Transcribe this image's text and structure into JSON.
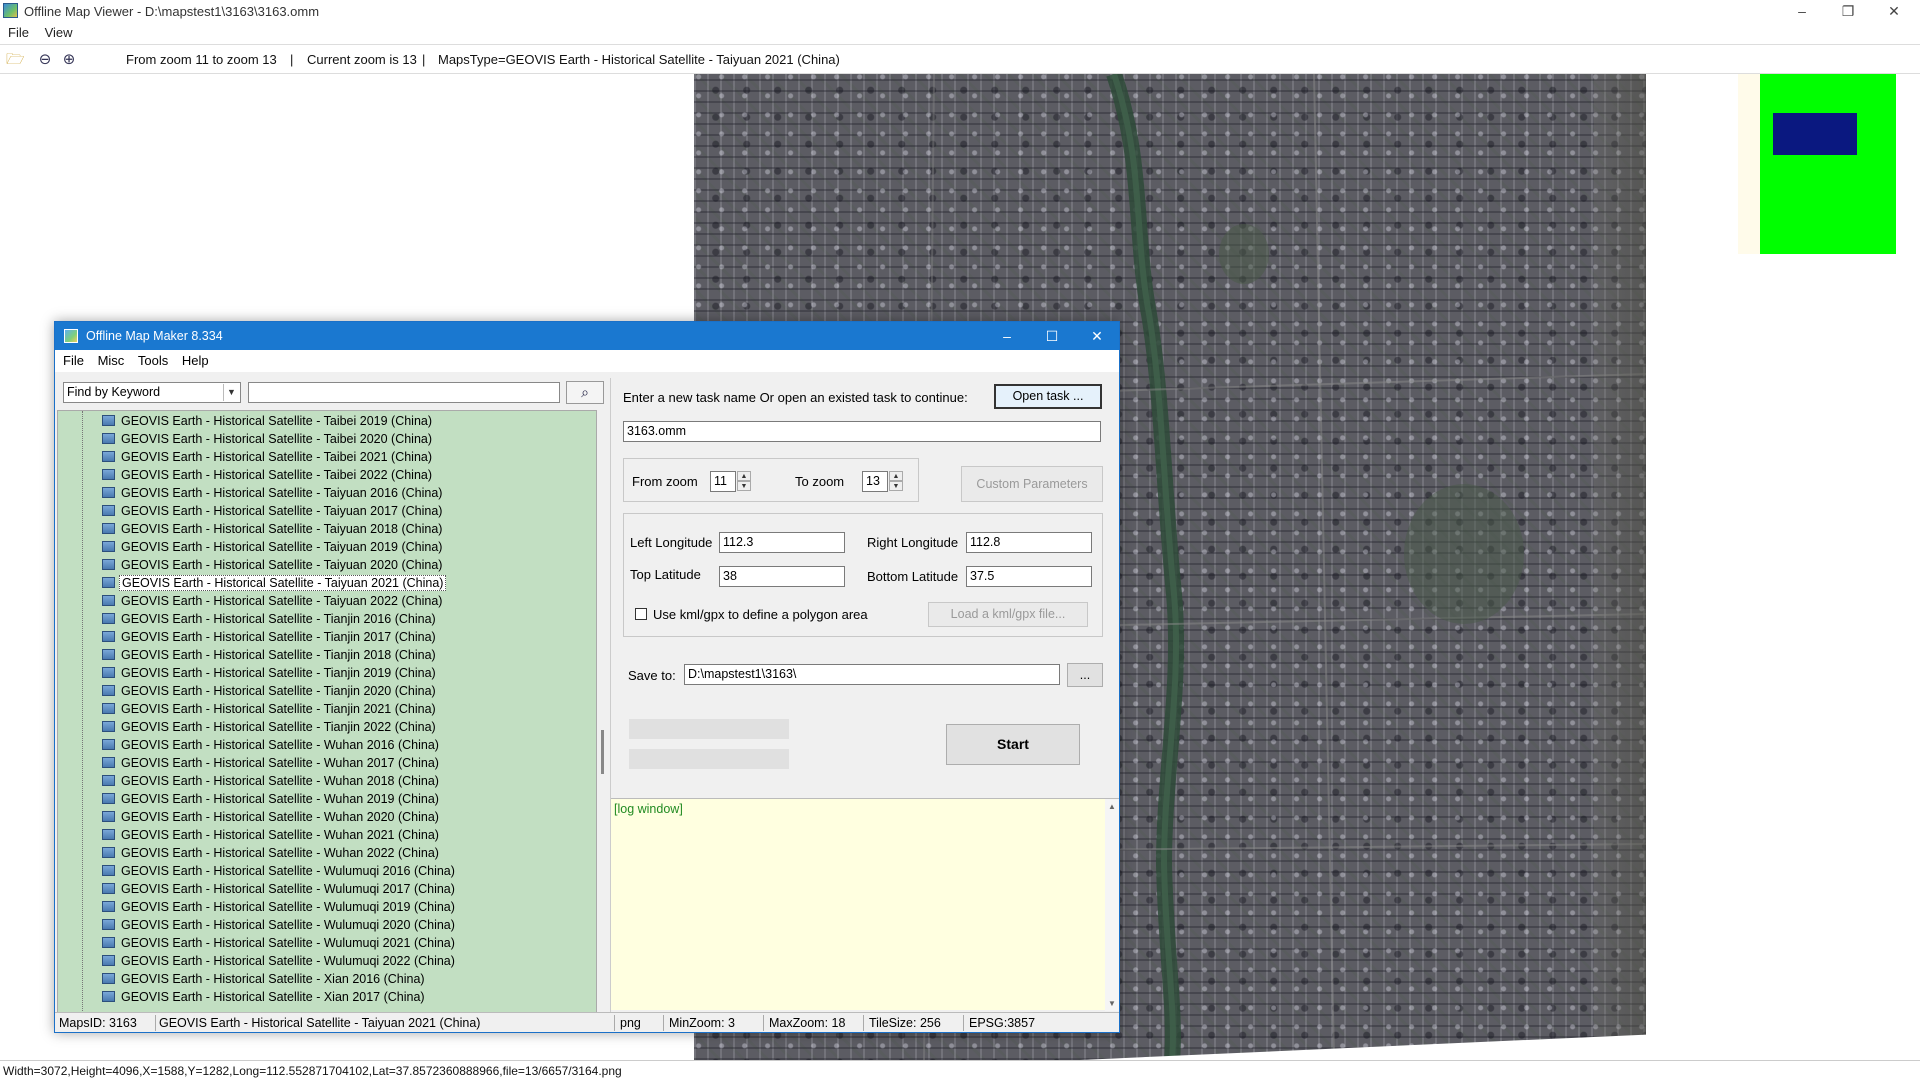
{
  "viewer": {
    "title": "Offline Map Viewer - D:\\mapstest1\\3163\\3163.omm",
    "window_buttons": {
      "minimize": "–",
      "maximize": "❐",
      "close": "✕"
    },
    "menu": [
      "File",
      "View"
    ],
    "toolbar": {
      "zoom_range": "From zoom 11 to zoom 13",
      "separator": "|",
      "current_zoom": "Current zoom is 13",
      "maps_type": "MapsType=GEOVIS Earth - Historical Satellite - Taiyuan 2021 (China)"
    },
    "status": "Width=3072,Height=4096,X=1588,Y=1282,Long=112.552871704102,Lat=37.8572360888966,file=13/6657/3164.png",
    "overview_colors": {
      "frame": "#00ff00",
      "viewport": "#0a1880"
    }
  },
  "dialog": {
    "title": "Offline Map Maker 8.334",
    "window_buttons": {
      "minimize": "–",
      "maximize": "☐",
      "close": "✕"
    },
    "menu": [
      "File",
      "Misc",
      "Tools",
      "Help"
    ],
    "find": {
      "mode": "Find by Keyword",
      "query": ""
    },
    "tree_items": [
      "GEOVIS Earth - Historical Satellite - Taibei 2019 (China)",
      "GEOVIS Earth - Historical Satellite - Taibei 2020 (China)",
      "GEOVIS Earth - Historical Satellite - Taibei 2021 (China)",
      "GEOVIS Earth - Historical Satellite - Taibei 2022 (China)",
      "GEOVIS Earth - Historical Satellite - Taiyuan 2016 (China)",
      "GEOVIS Earth - Historical Satellite - Taiyuan 2017 (China)",
      "GEOVIS Earth - Historical Satellite - Taiyuan 2018 (China)",
      "GEOVIS Earth - Historical Satellite - Taiyuan 2019 (China)",
      "GEOVIS Earth - Historical Satellite - Taiyuan 2020 (China)",
      "GEOVIS Earth - Historical Satellite - Taiyuan 2021 (China)",
      "GEOVIS Earth - Historical Satellite - Taiyuan 2022 (China)",
      "GEOVIS Earth - Historical Satellite - Tianjin 2016 (China)",
      "GEOVIS Earth - Historical Satellite - Tianjin 2017 (China)",
      "GEOVIS Earth - Historical Satellite - Tianjin 2018 (China)",
      "GEOVIS Earth - Historical Satellite - Tianjin 2019 (China)",
      "GEOVIS Earth - Historical Satellite - Tianjin 2020 (China)",
      "GEOVIS Earth - Historical Satellite - Tianjin 2021 (China)",
      "GEOVIS Earth - Historical Satellite - Tianjin 2022 (China)",
      "GEOVIS Earth - Historical Satellite - Wuhan 2016 (China)",
      "GEOVIS Earth - Historical Satellite - Wuhan 2017 (China)",
      "GEOVIS Earth - Historical Satellite - Wuhan 2018 (China)",
      "GEOVIS Earth - Historical Satellite - Wuhan 2019 (China)",
      "GEOVIS Earth - Historical Satellite - Wuhan 2020 (China)",
      "GEOVIS Earth - Historical Satellite - Wuhan 2021 (China)",
      "GEOVIS Earth - Historical Satellite - Wuhan 2022 (China)",
      "GEOVIS Earth - Historical Satellite - Wulumuqi 2016 (China)",
      "GEOVIS Earth - Historical Satellite - Wulumuqi 2017 (China)",
      "GEOVIS Earth - Historical Satellite - Wulumuqi 2019 (China)",
      "GEOVIS Earth - Historical Satellite - Wulumuqi 2020 (China)",
      "GEOVIS Earth - Historical Satellite - Wulumuqi 2021 (China)",
      "GEOVIS Earth - Historical Satellite - Wulumuqi 2022 (China)",
      "GEOVIS Earth - Historical Satellite - Xian 2016 (China)",
      "GEOVIS Earth - Historical Satellite - Xian 2017 (China)"
    ],
    "selected_item": "GEOVIS Earth - Historical Satellite - Taiyuan 2021 (China)",
    "task": {
      "prompt": "Enter a new task name Or open an existed task to continue:",
      "open_button": "Open task ...",
      "name": "3163.omm"
    },
    "zoom": {
      "from_label": "From zoom",
      "from_value": "11",
      "to_label": "To zoom",
      "to_value": "13",
      "custom_button": "Custom Parameters"
    },
    "bounds": {
      "left_lon_label": "Left Longitude",
      "left_lon": "112.3",
      "right_lon_label": "Right Longitude",
      "right_lon": "112.8",
      "top_lat_label": "Top Latitude",
      "top_lat": "38",
      "bottom_lat_label": "Bottom Latitude",
      "bottom_lat": "37.5",
      "kml_checkbox_label": "Use kml/gpx to define a polygon area",
      "kml_checked": false,
      "load_kml_button": "Load a kml/gpx file..."
    },
    "save": {
      "label": "Save to:",
      "path": "D:\\mapstest1\\3163\\",
      "browse_button": "..."
    },
    "start_button": "Start",
    "log_title": "[log window]",
    "status": {
      "maps_id": "MapsID: 3163",
      "maps_name": "GEOVIS Earth - Historical Satellite - Taiyuan 2021 (China)",
      "format": "png",
      "min_zoom": "MinZoom: 3",
      "max_zoom": "MaxZoom: 18",
      "tile_size": "TileSize: 256",
      "epsg": "EPSG:3857"
    }
  }
}
